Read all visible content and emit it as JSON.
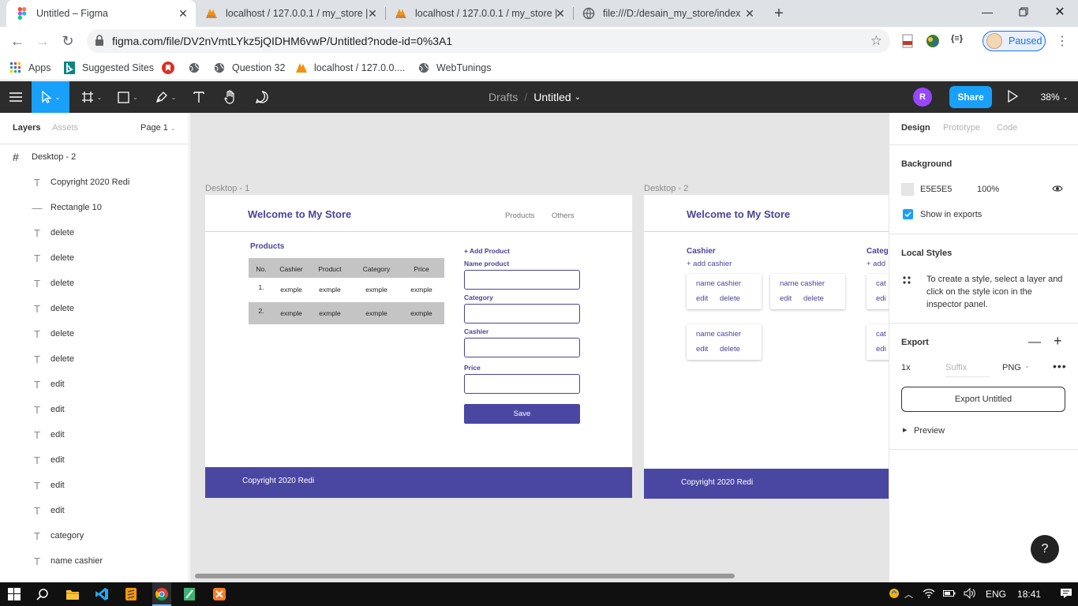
{
  "browser": {
    "tabs": [
      {
        "title": "Untitled – Figma",
        "icon": "figma-icon",
        "active": true
      },
      {
        "title": "localhost / 127.0.0.1 / my_store | ",
        "icon": "phpmyadmin-icon",
        "active": false
      },
      {
        "title": "localhost / 127.0.0.1 / my_store | ",
        "icon": "phpmyadmin-icon",
        "active": false
      },
      {
        "title": "file:///D:/desain_my_store/index.",
        "icon": "globe-icon",
        "active": false
      }
    ],
    "url": "figma.com/file/DV2nVmtLYkz5jQIDHM6vwP/Untitled?node-id=0%3A1",
    "profile_status": "Paused",
    "bookmarks": [
      {
        "label": "Apps",
        "icon": "apps-grid-icon"
      },
      {
        "label": "Suggested Sites",
        "icon": "bing-icon"
      },
      {
        "label": "",
        "icon": "bookmark-red-icon"
      },
      {
        "label": "",
        "icon": "globe-icon"
      },
      {
        "label": "Question 32",
        "icon": "globe-icon"
      },
      {
        "label": "localhost / 127.0.0....",
        "icon": "phpmyadmin-icon"
      },
      {
        "label": "WebTunings",
        "icon": "globe-icon"
      }
    ]
  },
  "figma": {
    "breadcrumb": {
      "drafts": "Drafts",
      "separator": "/",
      "file": "Untitled"
    },
    "user_initial": "R",
    "share_label": "Share",
    "zoom": "38%",
    "left_panel": {
      "tabs": {
        "layers": "Layers",
        "assets": "Assets",
        "page": "Page 1"
      },
      "frame_name": "Desktop - 2",
      "layers": [
        {
          "name": "Copyright 2020 Redi",
          "type": "text"
        },
        {
          "name": "Rectangle 10",
          "type": "line"
        },
        {
          "name": "delete",
          "type": "text"
        },
        {
          "name": "delete",
          "type": "text"
        },
        {
          "name": "delete",
          "type": "text"
        },
        {
          "name": "delete",
          "type": "text"
        },
        {
          "name": "delete",
          "type": "text"
        },
        {
          "name": "delete",
          "type": "text"
        },
        {
          "name": "edit",
          "type": "text"
        },
        {
          "name": "edit",
          "type": "text"
        },
        {
          "name": "edit",
          "type": "text"
        },
        {
          "name": "edit",
          "type": "text"
        },
        {
          "name": "edit",
          "type": "text"
        },
        {
          "name": "edit",
          "type": "text"
        },
        {
          "name": "category",
          "type": "text"
        },
        {
          "name": "name cashier",
          "type": "text"
        }
      ]
    },
    "canvas": {
      "frame1": {
        "label": "Desktop - 1",
        "title": "Welcome to My Store",
        "nav": [
          "Products",
          "Others"
        ],
        "products_title": "Products",
        "table_headers": [
          "No.",
          "Cashier",
          "Product",
          "Category",
          "Price"
        ],
        "table_rows": [
          [
            "1.",
            "exmple",
            "exmple",
            "exmple",
            "exmple"
          ],
          [
            "2.",
            "exmple",
            "exmple",
            "exmple",
            "exmple"
          ]
        ],
        "form": {
          "add_label": "+ Add Product",
          "fields": [
            "Name product",
            "Category",
            "Cashier",
            "Price"
          ],
          "save_label": "Save"
        },
        "footer": "Copyright 2020 Redi"
      },
      "frame2": {
        "label": "Desktop - 2",
        "title": "Welcome to My Store",
        "cashier_title": "Cashier",
        "add_cashier": "+ add cashier",
        "category_title_partial": "Categ",
        "add_partial": "+ add",
        "card_name": "name cashier",
        "card_edit": "edit",
        "card_delete": "delete",
        "cat_partial": "cat",
        "edit_partial": "edi",
        "footer": "Copyright 2020 Redi"
      }
    },
    "right_panel": {
      "tabs": {
        "design": "Design",
        "prototype": "Prototype",
        "code": "Code"
      },
      "background_title": "Background",
      "bg_hex": "E5E5E5",
      "bg_opacity": "100%",
      "show_in_exports": "Show in exports",
      "local_styles_title": "Local Styles",
      "local_styles_hint": "To create a style, select a layer and click on the style icon in the inspector panel.",
      "export_title": "Export",
      "export_scale": "1x",
      "export_suffix_placeholder": "Suffix",
      "export_format": "PNG",
      "export_button": "Export Untitled",
      "preview_label": "Preview"
    },
    "help": "?"
  },
  "taskbar": {
    "lang": "ENG",
    "time": "18:41"
  },
  "colors": {
    "figma_blue": "#18a0fb",
    "store_purple": "#4a47a3",
    "canvas_bg": "#e5e5e5"
  }
}
